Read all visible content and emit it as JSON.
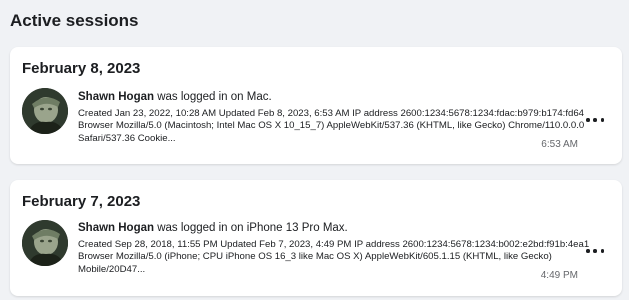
{
  "header": {
    "title": "Active sessions"
  },
  "sessions": [
    {
      "date": "February 8, 2023",
      "user": "Shawn Hogan",
      "action": " was logged in on Mac.",
      "details": "Created Jan 23, 2022, 10:28 AM Updated Feb 8, 2023, 6:53 AM IP address 2600:1234:5678:1234:fdac:b979:b174:fd64 Browser Mozilla/5.0 (Macintosh; Intel Mac OS X 10_15_7) AppleWebKit/537.36 (KHTML, like Gecko) Chrome/110.0.0.0 Safari/537.36 Cookie...",
      "time": "6:53 AM",
      "icon": "more-dots-icon"
    },
    {
      "date": "February 7, 2023",
      "user": "Shawn Hogan",
      "action": " was logged in on iPhone 13 Pro Max.",
      "details": "Created Sep 28, 2018, 11:55 PM Updated Feb 7, 2023, 4:49 PM IP address 2600:1234:5678:1234:b002:e2bd:f91b:4ea1 Browser Mozilla/5.0 (iPhone; CPU iPhone OS 16_3 like Mac OS X) AppleWebKit/605.1.15 (KHTML, like Gecko) Mobile/20D47...",
      "time": "4:49 PM",
      "icon": "more-dots-icon"
    }
  ],
  "colors": {
    "background": "#f0f2f5",
    "card": "#ffffff",
    "muted_text": "#65676b"
  }
}
